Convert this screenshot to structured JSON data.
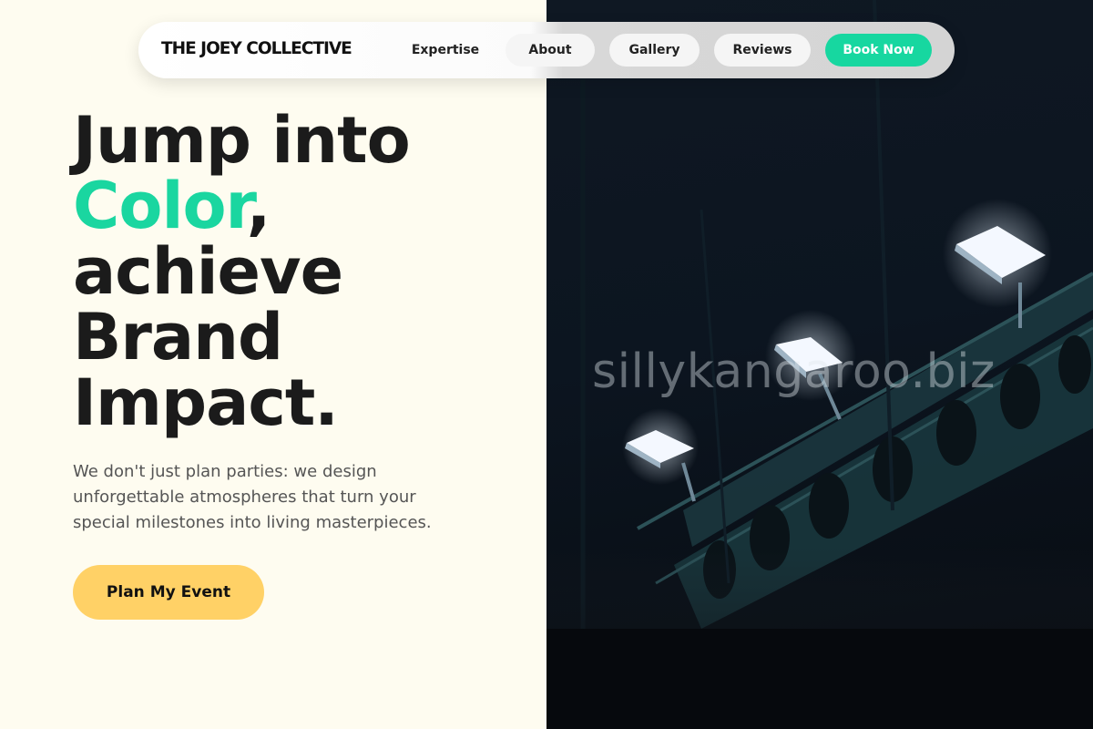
{
  "nav": {
    "brand": "THE JOEY COLLECTIVE",
    "links": [
      {
        "label": "Expertise"
      },
      {
        "label": "About"
      },
      {
        "label": "Gallery"
      },
      {
        "label": "Reviews"
      }
    ],
    "book_label": "Book Now"
  },
  "hero": {
    "line1": "Jump into",
    "accent_word": "Color",
    "accent_punct": ",",
    "line3": "achieve",
    "line4": "Brand",
    "line5": "Impact.",
    "subtext": "We don't just plan parties: we design unforgettable atmospheres that turn your special milestones into living masterpieces.",
    "cta_label": "Plan My Event"
  },
  "image": {
    "watermark": "sillykangaroo.biz",
    "subject": "stage-lights-photo"
  },
  "colors": {
    "accent": "#1ad6a0",
    "cta": "#ffd166",
    "background": "#fefcf0",
    "text": "#1b1b1b"
  }
}
